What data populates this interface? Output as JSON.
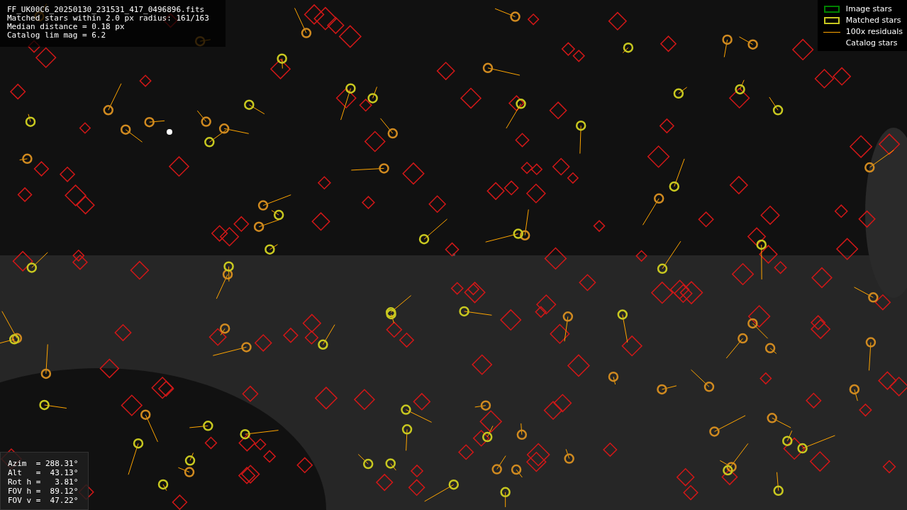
{
  "info": {
    "lines": [
      "FF_UK00C6_20250130_231531_417_0496896.fits",
      "Matched stars within 2.0 px radius: 161/163",
      "Median distance = 0.18 px",
      "Catalog lim mag = 6.2"
    ]
  },
  "legend": [
    {
      "label": "Image stars",
      "kind": "box",
      "color": "#008000"
    },
    {
      "label": "Matched stars",
      "kind": "box",
      "color": "#c8c820"
    },
    {
      "label": "100x residuals",
      "kind": "line",
      "color": "#ffa500"
    },
    {
      "label": "Catalog stars",
      "kind": "none"
    }
  ],
  "pointing": {
    "lines": [
      "Azim  = 288.31°",
      "Alt   =  43.13°",
      "Rot h =   3.81°",
      "FOV h =  89.12°",
      "FOV v =  47.22°"
    ]
  }
}
